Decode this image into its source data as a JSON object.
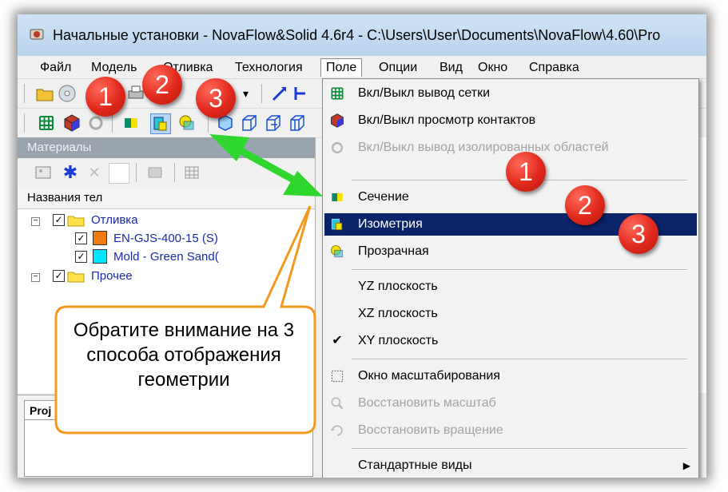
{
  "window": {
    "title": "Начальные установки - NovaFlow&Solid 4.6r4 - C:\\Users\\User\\Documents\\NovaFlow\\4.60\\Pro"
  },
  "menubar": {
    "items": [
      "Файл",
      "Модель",
      "Отливка",
      "Технология",
      "Поле",
      "Опции",
      "Вид",
      "Окно",
      "Справка"
    ],
    "active": "Поле"
  },
  "panels": {
    "materials_header": "Материалы",
    "column_header": "Названия тел",
    "bottom_tab": "Proj"
  },
  "tree": {
    "items": [
      {
        "label": "Отливка",
        "level": 0,
        "checked": true,
        "icon": "folder-icon"
      },
      {
        "label": "EN-GJS-400-15 (S)",
        "level": 1,
        "checked": true,
        "color": "#f07a10"
      },
      {
        "label": "Mold - Green Sand(",
        "level": 1,
        "checked": true,
        "color": "#00e5ff"
      },
      {
        "label": "Прочее",
        "level": 0,
        "checked": true,
        "icon": "folder-icon"
      }
    ]
  },
  "dropdown": {
    "items": [
      {
        "label": "Вкл/Выкл вывод сетки",
        "icon": "grid-icon",
        "state": "normal"
      },
      {
        "label": "Вкл/Выкл просмотр контактов",
        "icon": "contacts-cube-icon",
        "state": "normal"
      },
      {
        "label": "Вкл/Выкл вывод изолированных областей",
        "icon": "isolated-rings-icon",
        "state": "disabled"
      },
      {
        "label": "Сечение",
        "icon": "section-icon",
        "state": "normal"
      },
      {
        "label": "Изометрия",
        "icon": "isometry-icon",
        "state": "highlighted"
      },
      {
        "label": "Прозрачная",
        "icon": "transparent-icon",
        "state": "normal"
      },
      {
        "label": "YZ плоскость",
        "icon": "",
        "state": "normal"
      },
      {
        "label": "XZ плоскость",
        "icon": "",
        "state": "normal"
      },
      {
        "label": "XY плоскость",
        "icon": "checkmark-icon",
        "state": "checked"
      },
      {
        "label": "Окно масштабирования",
        "icon": "zoom-window-icon",
        "state": "normal"
      },
      {
        "label": "Восстановить масштаб",
        "icon": "zoom-restore-icon",
        "state": "disabled"
      },
      {
        "label": "Восстановить вращение",
        "icon": "rotate-restore-icon",
        "state": "disabled"
      },
      {
        "label": "Стандартные виды",
        "icon": "",
        "state": "submenu"
      }
    ]
  },
  "annotations": {
    "badges": [
      "1",
      "2",
      "3",
      "1",
      "2",
      "3"
    ],
    "callout_text": "Обратите внимание на  3 способа отображения геометрии"
  },
  "colors": {
    "highlight": "#0a246a",
    "badge_red": "#e0281c",
    "arrow_green": "#2ed62e",
    "callout_border": "#f39a1e"
  }
}
